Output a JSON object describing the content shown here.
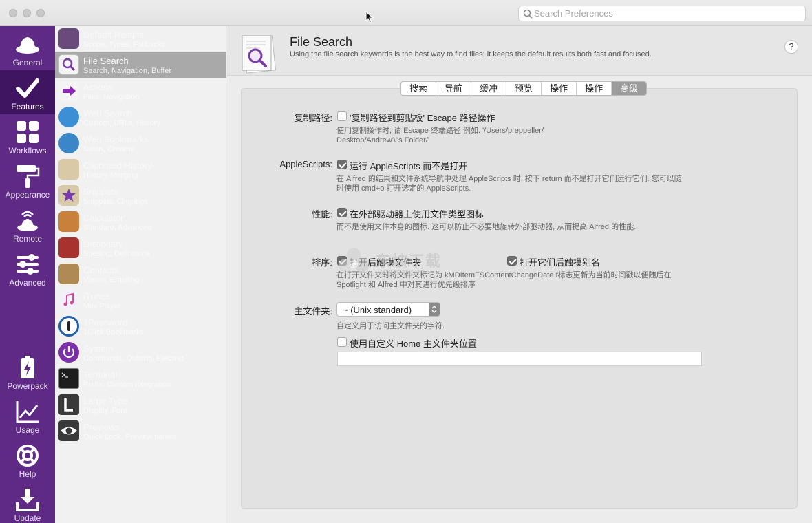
{
  "search": {
    "placeholder": "Search Preferences"
  },
  "nav": [
    {
      "label": "General",
      "icon": "hat-icon"
    },
    {
      "label": "Features",
      "icon": "checkmark-icon"
    },
    {
      "label": "Workflows",
      "icon": "grid-icon"
    },
    {
      "label": "Appearance",
      "icon": "paint-roller-icon"
    },
    {
      "label": "Remote",
      "icon": "remote-icon"
    },
    {
      "label": "Advanced",
      "icon": "sliders-icon"
    },
    {
      "label": "Powerpack",
      "icon": "battery-bolt-icon"
    },
    {
      "label": "Usage",
      "icon": "chart-line-icon"
    },
    {
      "label": "Help",
      "icon": "lifebuoy-icon"
    },
    {
      "label": "Update",
      "icon": "download-icon"
    }
  ],
  "features": [
    {
      "name": "Default Results",
      "sub": "Scope, Types, Fallbacks"
    },
    {
      "name": "File Search",
      "sub": "Search, Navigation, Buffer"
    },
    {
      "name": "Actions",
      "sub": "Files, Navigation"
    },
    {
      "name": "Web Search",
      "sub": "Custom, URLs, History"
    },
    {
      "name": "Web Bookmarks",
      "sub": "Safari, Chrome"
    },
    {
      "name": "Clipboard History",
      "sub": "History, Merging"
    },
    {
      "name": "Snippets",
      "sub": "Snippets, Clippings"
    },
    {
      "name": "Calculator",
      "sub": "Standard, Advanced"
    },
    {
      "name": "Dictionary",
      "sub": "Spelling, Definitions"
    },
    {
      "name": "Contacts",
      "sub": "Viewer, Emailing"
    },
    {
      "name": "iTunes",
      "sub": "Mini Player"
    },
    {
      "name": "1Password",
      "sub": "1Click Bookmarks"
    },
    {
      "name": "System",
      "sub": "Commands, Quitting, Ejecting"
    },
    {
      "name": "Terminal",
      "sub": "Prefix, Custom Integration"
    },
    {
      "name": "Large Type",
      "sub": "Display, Font"
    },
    {
      "name": "Previews",
      "sub": "Quick Look, Preview panels"
    }
  ],
  "header": {
    "title": "File Search",
    "description": "Using the file search keywords is the best way to find files; it keeps the default results both fast and focused.",
    "help": "?"
  },
  "tabs": [
    "搜索",
    "导航",
    "缓冲",
    "预览",
    "操作",
    "操作",
    "高级"
  ],
  "settings": {
    "copy_path": {
      "label": "复制路径:",
      "checkbox": "'复制路径到剪贴板' Escape 路径操作",
      "checked": false,
      "desc1": "使用复制操作时, 请 Escape 终端路径 例如. '/Users/preppeller/",
      "desc2": "Desktop/Andrew'\\''s Folder/'"
    },
    "applescripts": {
      "label": "AppleScripts:",
      "checkbox": "运行 AppleScripts 而不是打开",
      "checked": true,
      "desc1": "在 Alfred 的结果和文件系统导航中处理 AppleScripts 时, 按下 return 而不是打开它们运行它们. 您可以随",
      "desc2": "时使用 cmd+o 打开选定的 AppleScripts."
    },
    "performance": {
      "label": "性能:",
      "checkbox": "在外部驱动器上使用文件类型图标",
      "checked": true,
      "desc1": "而不是使用文件本身的图标. 这可以防止不必要地旋转外部驱动器, 从而提高 Alfred 的性能."
    },
    "sorting": {
      "label": "排序:",
      "checkbox1": "打开后触摸文件夹",
      "checked1": true,
      "checkbox2": "打开它们后触摸别名",
      "checked2": true,
      "desc1": "在打开文件夹时将文件夹标记为 kMDItemFSContentChangeDate f标志更新为当前时间戳以便随后在",
      "desc2": "Spotlight 和 Alfred 中对其进行优先级排序"
    },
    "home_folder": {
      "label": "主文件夹:",
      "select_value": "~ (Unix standard)",
      "desc1": "自定义用于访问主文件夹的字符.",
      "checkbox": "使用自定义 Home 主文件夹位置",
      "checked": false,
      "path_value": ""
    }
  },
  "watermark": {
    "text": "东坡下载",
    "url": "www.uzzf.com"
  },
  "colors": {
    "nav_bg": "#5e2a86",
    "nav_active": "#3f1461",
    "list_selected": "#a9a9a9"
  }
}
